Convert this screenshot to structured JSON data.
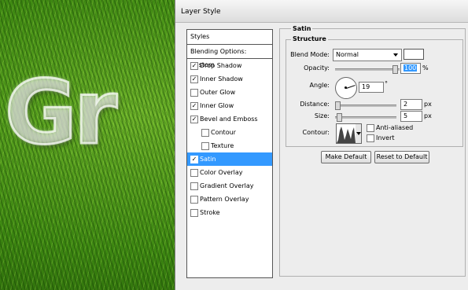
{
  "background": {
    "artwork_text": "Gr"
  },
  "dialog": {
    "title": "Layer Style"
  },
  "styles_list": {
    "header": "Styles",
    "blending_options": "Blending Options: Custom",
    "items": [
      {
        "label": "Drop Shadow",
        "checked": true,
        "sub": false,
        "selected": false
      },
      {
        "label": "Inner Shadow",
        "checked": true,
        "sub": false,
        "selected": false
      },
      {
        "label": "Outer Glow",
        "checked": false,
        "sub": false,
        "selected": false
      },
      {
        "label": "Inner Glow",
        "checked": true,
        "sub": false,
        "selected": false
      },
      {
        "label": "Bevel and Emboss",
        "checked": true,
        "sub": false,
        "selected": false
      },
      {
        "label": "Contour",
        "checked": false,
        "sub": true,
        "selected": false
      },
      {
        "label": "Texture",
        "checked": false,
        "sub": true,
        "selected": false
      },
      {
        "label": "Satin",
        "checked": true,
        "sub": false,
        "selected": true
      },
      {
        "label": "Color Overlay",
        "checked": false,
        "sub": false,
        "selected": false
      },
      {
        "label": "Gradient Overlay",
        "checked": false,
        "sub": false,
        "selected": false
      },
      {
        "label": "Pattern Overlay",
        "checked": false,
        "sub": false,
        "selected": false
      },
      {
        "label": "Stroke",
        "checked": false,
        "sub": false,
        "selected": false
      }
    ]
  },
  "satin": {
    "group_title": "Satin",
    "structure_title": "Structure",
    "blend_mode_label": "Blend Mode:",
    "blend_mode_value": "Normal",
    "blend_color": "#ffffff",
    "opacity_label": "Opacity:",
    "opacity_value": "100",
    "opacity_unit": "%",
    "angle_label": "Angle:",
    "angle_value": "19",
    "angle_unit": "°",
    "distance_label": "Distance:",
    "distance_value": "2",
    "distance_unit": "px",
    "size_label": "Size:",
    "size_value": "5",
    "size_unit": "px",
    "contour_label": "Contour:",
    "anti_aliased_label": "Anti-aliased",
    "anti_aliased_checked": false,
    "invert_label": "Invert",
    "invert_checked": false,
    "make_default_label": "Make Default",
    "reset_default_label": "Reset to Default"
  },
  "colors": {
    "selection": "#3399ff",
    "dialog_bg": "#ededed"
  }
}
